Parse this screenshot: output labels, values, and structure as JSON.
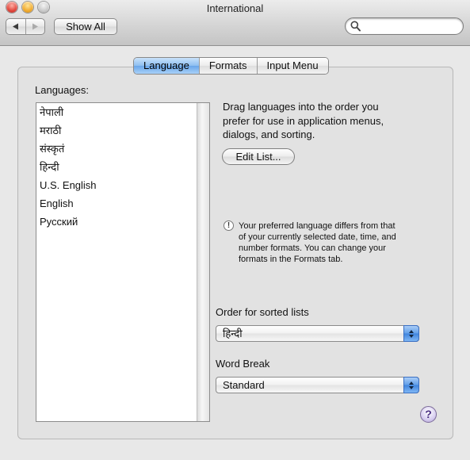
{
  "window": {
    "title": "International"
  },
  "toolbar": {
    "back_icon": "triangle-left-icon",
    "forward_icon": "triangle-right-icon",
    "show_all_label": "Show All",
    "search_value": "",
    "search_icon": "magnifier-icon"
  },
  "tabs": [
    {
      "label": "Language",
      "active": true
    },
    {
      "label": "Formats",
      "active": false
    },
    {
      "label": "Input Menu",
      "active": false
    }
  ],
  "languages": {
    "label": "Languages:",
    "items": [
      "नेपाली",
      "मराठी",
      "संस्कृतं",
      "हिन्दी",
      "U.S. English",
      "English",
      "Русский"
    ]
  },
  "instructions": {
    "line1": "Drag languages into the order you",
    "line2": "prefer for use in application menus,",
    "line3": "dialogs, and sorting.",
    "edit_list_label": "Edit List..."
  },
  "warning": {
    "icon_glyph": "!",
    "line1": "Your preferred language differs from that",
    "line2": "of your currently selected date, time, and",
    "line3": "number formats. You can change your",
    "line4": "formats in the Formats tab."
  },
  "sorted_lists": {
    "label": "Order for sorted lists",
    "selected": "हिन्दी"
  },
  "word_break": {
    "label": "Word Break",
    "selected": "Standard"
  },
  "help": {
    "glyph": "?"
  },
  "colors": {
    "accent": "#69a6ea",
    "popup_arrow": "#3e83dd"
  }
}
